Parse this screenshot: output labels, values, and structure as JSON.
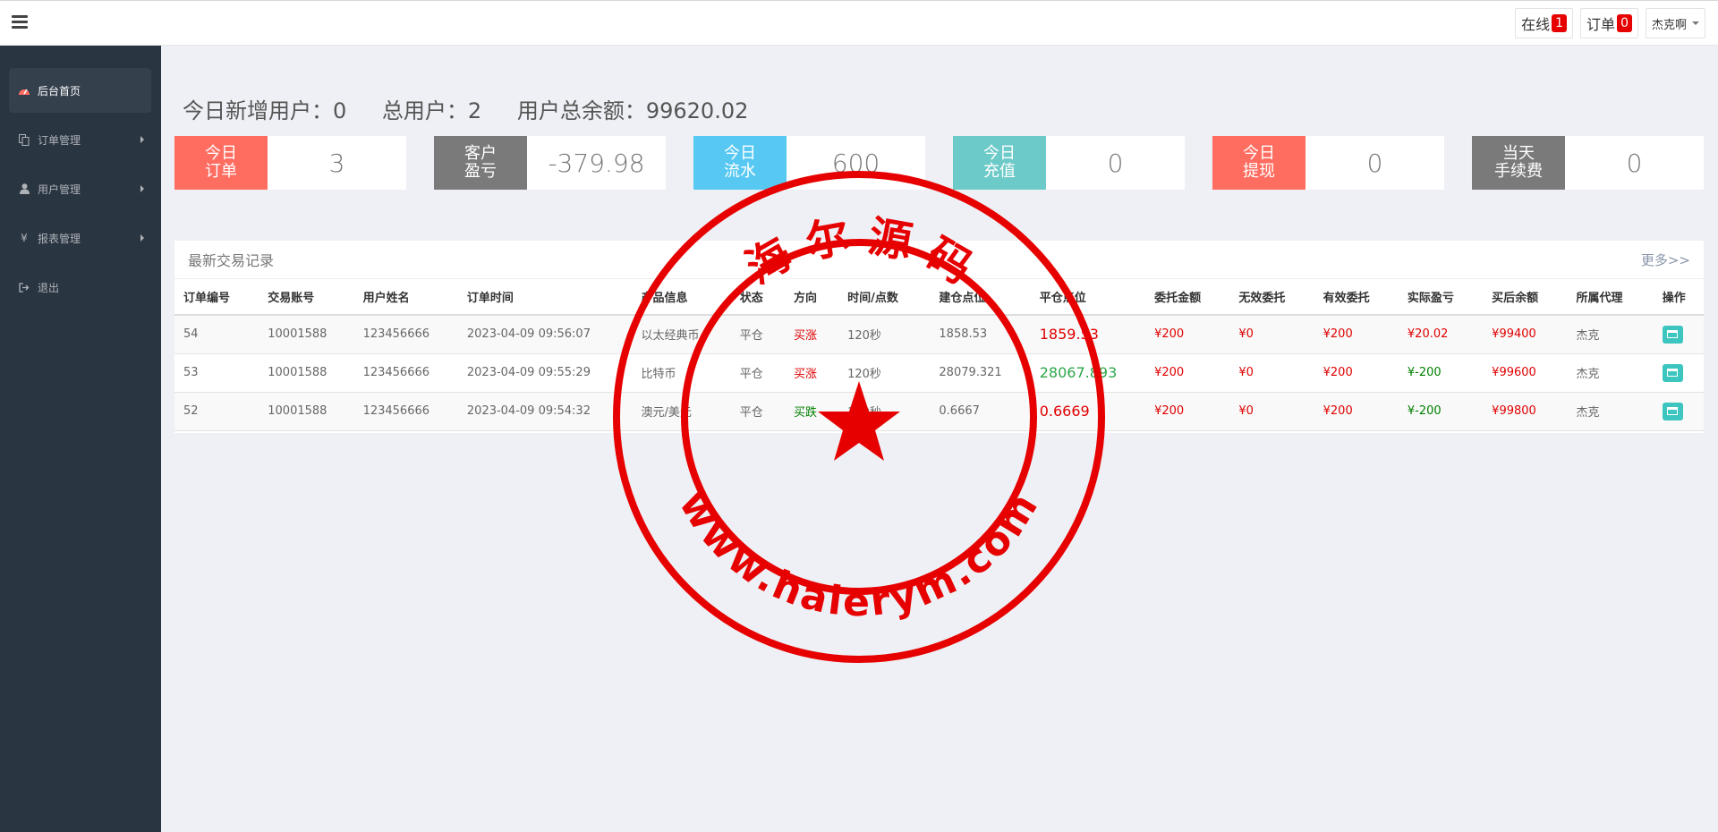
{
  "topbar": {
    "online_label": "在线",
    "online_count": "1",
    "orders_label": "订单",
    "orders_count": "0",
    "user_name": "杰克啊"
  },
  "sidebar": {
    "items": [
      {
        "label": "后台首页",
        "icon": "dashboard-icon"
      },
      {
        "label": "订单管理",
        "icon": "copy-icon"
      },
      {
        "label": "用户管理",
        "icon": "user-icon"
      },
      {
        "label": "报表管理",
        "icon": "yen-icon"
      },
      {
        "label": "退出",
        "icon": "sign-out-icon"
      }
    ]
  },
  "stats": {
    "new_users": "今日新增用户：0",
    "total_users": "总用户：2",
    "total_balance": "用户总余额：99620.02"
  },
  "cards": [
    {
      "line1": "今日",
      "line2": "订单",
      "value": "3",
      "color": "#ff6c60"
    },
    {
      "line1": "客户",
      "line2": "盈亏",
      "value": "-379.98",
      "color": "#7a7a7a"
    },
    {
      "line1": "今日",
      "line2": "流水",
      "value": "600",
      "color": "#57c8f2"
    },
    {
      "line1": "今日",
      "line2": "充值",
      "value": "0",
      "color": "#6ccac9"
    },
    {
      "line1": "今日",
      "line2": "提现",
      "value": "0",
      "color": "#ff6c60"
    },
    {
      "line1": "当天",
      "line2": "手续费",
      "value": "0",
      "color": "#7a7a7a"
    }
  ],
  "panel": {
    "title": "最新交易记录",
    "more": "更多>>"
  },
  "table": {
    "headers": [
      "订单编号",
      "交易账号",
      "用户姓名",
      "订单时间",
      "产品信息",
      "状态",
      "方向",
      "时间/点数",
      "建仓点位",
      "平仓点位",
      "委托金额",
      "无效委托",
      "有效委托",
      "实际盈亏",
      "买后余额",
      "所属代理",
      "操作"
    ],
    "rows": [
      [
        "54",
        "10001588",
        "123456666",
        "2023-04-09 09:56:07",
        "以太经典币",
        "平仓",
        "买涨",
        "120秒",
        "1858.53",
        "1859.53",
        "¥200",
        "¥0",
        "¥200",
        "¥20.02",
        "¥99400",
        "杰克"
      ],
      [
        "53",
        "10001588",
        "123456666",
        "2023-04-09 09:55:29",
        "比特币",
        "平仓",
        "买涨",
        "120秒",
        "28079.321",
        "28067.893",
        "¥200",
        "¥0",
        "¥200",
        "¥-200",
        "¥99600",
        "杰克"
      ],
      [
        "52",
        "10001588",
        "123456666",
        "2023-04-09 09:54:32",
        "澳元/美元",
        "平仓",
        "买跌",
        "120秒",
        "0.6667",
        "0.6669",
        "¥200",
        "¥0",
        "¥200",
        "¥-200",
        "¥99800",
        "杰克"
      ]
    ],
    "direction_colors": [
      "red",
      "red",
      "green"
    ],
    "close_colors": [
      "big-red",
      "big-green",
      "big-red"
    ],
    "pl_colors": [
      "red",
      "green",
      "green"
    ]
  },
  "stamp": {
    "top_text": "海 尔 源 码",
    "bottom_text": "www.haierym.com",
    "color": "#e60000"
  }
}
